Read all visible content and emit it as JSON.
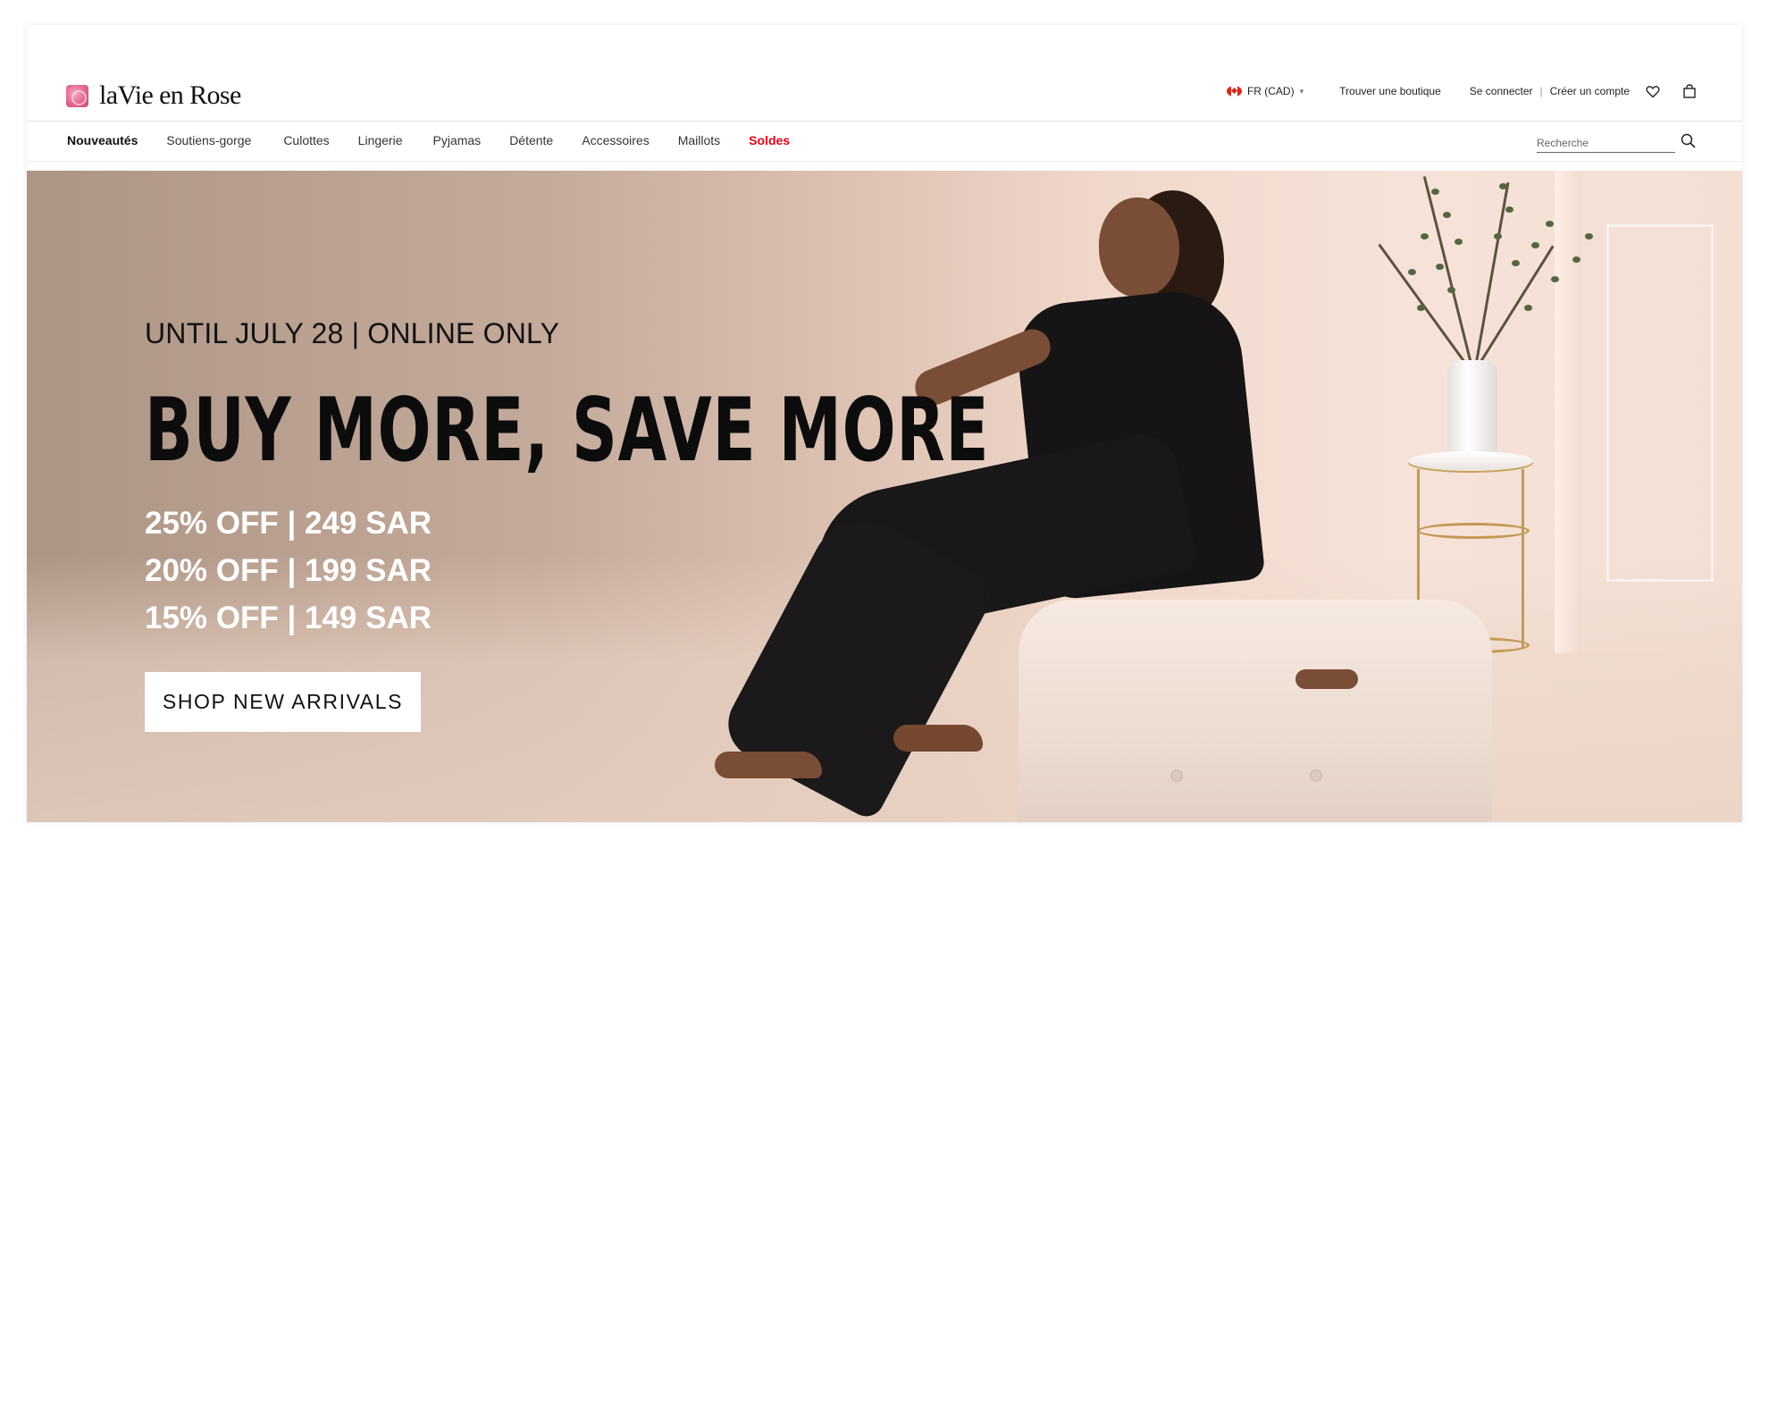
{
  "brand": {
    "name": "laVie en Rose",
    "accent_color": "#e2001a",
    "logo_icon": "rose-logo-icon"
  },
  "utility": {
    "locale_label": "FR (CAD)",
    "locale_icon": "canada-flag-icon",
    "store_finder": "Trouver une boutique",
    "sign_in": "Se connecter",
    "separator": "|",
    "create_account": "Créer un compte",
    "wishlist_icon": "heart-icon",
    "cart_icon": "shopping-bag-icon"
  },
  "nav": {
    "items": [
      {
        "label": "Nouveautés"
      },
      {
        "label": "Soutiens-gorge"
      },
      {
        "label": "Culottes"
      },
      {
        "label": "Lingerie"
      },
      {
        "label": "Pyjamas"
      },
      {
        "label": "Détente"
      },
      {
        "label": "Accessoires"
      },
      {
        "label": "Maillots"
      },
      {
        "label": "Soldes"
      }
    ],
    "search_placeholder": "Recherche",
    "search_icon": "search-icon"
  },
  "hero": {
    "eyebrow": "UNTIL JULY 28 | ONLINE ONLY",
    "headline": "BUY MORE, SAVE MORE",
    "offers": [
      "25% OFF | 249 SAR",
      "20% OFF | 199 SAR",
      "15% OFF | 149 SAR"
    ],
    "cta_label": "SHOP NEW ARRIVALS"
  }
}
